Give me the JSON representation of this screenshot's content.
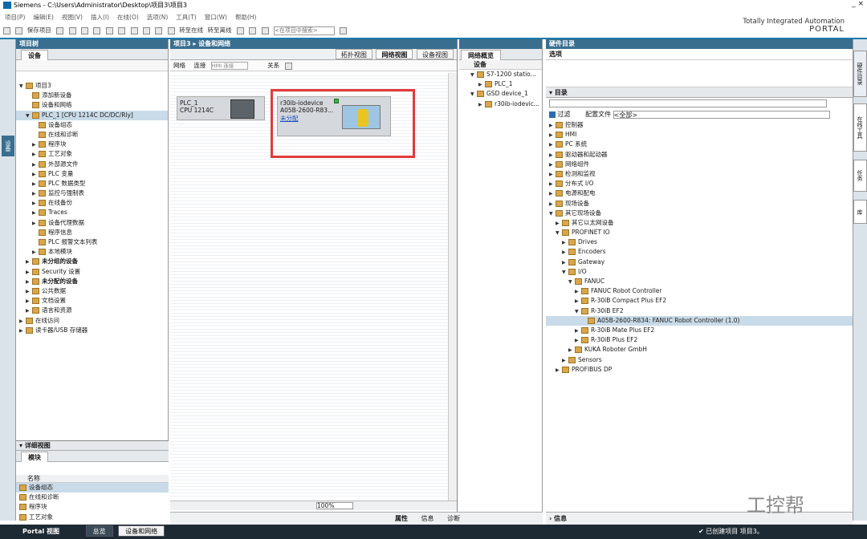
{
  "window": {
    "title": "Siemens  -  C:\\Users\\Administrator\\Desktop\\项目3\\项目3",
    "controls": "_ ×"
  },
  "menu": [
    "项目(P)",
    "编辑(E)",
    "视图(V)",
    "插入(I)",
    "在线(O)",
    "选项(N)",
    "工具(T)",
    "窗口(W)",
    "帮助(H)"
  ],
  "toolbar": {
    "save": "保存项目",
    "online": "转至在线",
    "offline": "转至离线",
    "search_placeholder": "<在项目中搜索>"
  },
  "brand": {
    "line1": "Totally Integrated Automation",
    "line2": "PORTAL"
  },
  "left_sidebar": {
    "tab": "设备"
  },
  "project_tree": {
    "header": "项目树",
    "tab": "设备",
    "items": [
      {
        "label": "项目3",
        "indent": 0,
        "arrow": "▼"
      },
      {
        "label": "添加新设备",
        "indent": 1,
        "arrow": ""
      },
      {
        "label": "设备和网络",
        "indent": 1,
        "arrow": ""
      },
      {
        "label": "PLC_1 [CPU 1214C DC/DC/Rly]",
        "indent": 1,
        "arrow": "▼",
        "selected": true
      },
      {
        "label": "设备组态",
        "indent": 2,
        "arrow": ""
      },
      {
        "label": "在线和诊断",
        "indent": 2,
        "arrow": ""
      },
      {
        "label": "程序块",
        "indent": 2,
        "arrow": "▶"
      },
      {
        "label": "工艺对象",
        "indent": 2,
        "arrow": "▶"
      },
      {
        "label": "外部源文件",
        "indent": 2,
        "arrow": "▶"
      },
      {
        "label": "PLC 变量",
        "indent": 2,
        "arrow": "▶"
      },
      {
        "label": "PLC 数据类型",
        "indent": 2,
        "arrow": "▶"
      },
      {
        "label": "监控与强制表",
        "indent": 2,
        "arrow": "▶"
      },
      {
        "label": "在线备份",
        "indent": 2,
        "arrow": "▶"
      },
      {
        "label": "Traces",
        "indent": 2,
        "arrow": "▶"
      },
      {
        "label": "设备代理数据",
        "indent": 2,
        "arrow": "▶"
      },
      {
        "label": "程序信息",
        "indent": 2,
        "arrow": ""
      },
      {
        "label": "PLC 报警文本列表",
        "indent": 2,
        "arrow": ""
      },
      {
        "label": "本地模块",
        "indent": 2,
        "arrow": "▶"
      },
      {
        "label": "未分组的设备",
        "indent": 1,
        "arrow": "▶",
        "bold": true
      },
      {
        "label": "Security 设置",
        "indent": 1,
        "arrow": "▶"
      },
      {
        "label": "未分配的设备",
        "indent": 1,
        "arrow": "▶",
        "bold": true
      },
      {
        "label": "公共数据",
        "indent": 1,
        "arrow": "▶"
      },
      {
        "label": "文档设置",
        "indent": 1,
        "arrow": "▶"
      },
      {
        "label": "语言和资源",
        "indent": 1,
        "arrow": "▶"
      },
      {
        "label": "在线访问",
        "indent": 0,
        "arrow": "▶"
      },
      {
        "label": "读卡器/USB 存储器",
        "indent": 0,
        "arrow": "▶"
      }
    ]
  },
  "detail_view": {
    "header": "详细视图",
    "tab": "模块",
    "column": "名称",
    "rows": [
      "设备组态",
      "在线和诊断",
      "程序块",
      "工艺对象"
    ]
  },
  "center": {
    "breadcrumb": "项目3 ▸ 设备和网络",
    "view_tabs": [
      "拓扑视图",
      "网络视图",
      "设备视图"
    ],
    "tools": {
      "network": "网络",
      "connect": "连接",
      "hmi_conn": "HMI 连接",
      "relation": "关系"
    },
    "plc": {
      "name": "PLC_1",
      "cpu": "CPU 1214C"
    },
    "device": {
      "name": "r30ib-iodevice",
      "model": "A05B-2600-R83...",
      "status": "未分配"
    },
    "zoom": "100%"
  },
  "overview": {
    "header": "网络概览",
    "col": "设备",
    "items": [
      {
        "label": "S7-1200 statio...",
        "indent": 1,
        "arrow": "▼"
      },
      {
        "label": "PLC_1",
        "indent": 2,
        "arrow": "▶"
      },
      {
        "label": "GSD device_1",
        "indent": 1,
        "arrow": "▼"
      },
      {
        "label": "r30ib-iodevic...",
        "indent": 2,
        "arrow": "▶"
      }
    ]
  },
  "catalog": {
    "header": "硬件目录",
    "options": "选项",
    "section": "目录",
    "filter": "过滤",
    "profile_label": "配置文件",
    "profile_value": "<全部>",
    "items": [
      {
        "label": "控制器",
        "indent": 0,
        "arrow": "▶"
      },
      {
        "label": "HMI",
        "indent": 0,
        "arrow": "▶"
      },
      {
        "label": "PC 系统",
        "indent": 0,
        "arrow": "▶"
      },
      {
        "label": "驱动器和起动器",
        "indent": 0,
        "arrow": "▶"
      },
      {
        "label": "网络组件",
        "indent": 0,
        "arrow": "▶"
      },
      {
        "label": "检测和监视",
        "indent": 0,
        "arrow": "▶"
      },
      {
        "label": "分布式 I/O",
        "indent": 0,
        "arrow": "▶"
      },
      {
        "label": "电源和配电",
        "indent": 0,
        "arrow": "▶"
      },
      {
        "label": "现场设备",
        "indent": 0,
        "arrow": "▶"
      },
      {
        "label": "其它现场设备",
        "indent": 0,
        "arrow": "▼"
      },
      {
        "label": "其它以太网设备",
        "indent": 1,
        "arrow": "▶"
      },
      {
        "label": "PROFINET IO",
        "indent": 1,
        "arrow": "▼"
      },
      {
        "label": "Drives",
        "indent": 2,
        "arrow": "▶"
      },
      {
        "label": "Encoders",
        "indent": 2,
        "arrow": "▶"
      },
      {
        "label": "Gateway",
        "indent": 2,
        "arrow": "▶"
      },
      {
        "label": "I/O",
        "indent": 2,
        "arrow": "▼"
      },
      {
        "label": "FANUC",
        "indent": 3,
        "arrow": "▼"
      },
      {
        "label": "FANUC Robot Controller",
        "indent": 4,
        "arrow": "▶"
      },
      {
        "label": "R-30iB Compact Plus EF2",
        "indent": 4,
        "arrow": "▶"
      },
      {
        "label": "R-30iB EF2",
        "indent": 4,
        "arrow": "▼"
      },
      {
        "label": "A05B-2600-R834: FANUC Robot Controller (1.0)",
        "indent": 5,
        "arrow": "",
        "selected": true
      },
      {
        "label": "R-30iB Mate Plus EF2",
        "indent": 4,
        "arrow": "▶"
      },
      {
        "label": "R-30iB Plus EF2",
        "indent": 4,
        "arrow": "▶"
      },
      {
        "label": "KUKA Roboter GmbH",
        "indent": 3,
        "arrow": "▶"
      },
      {
        "label": "Sensors",
        "indent": 2,
        "arrow": "▶"
      },
      {
        "label": "PROFIBUS DP",
        "indent": 1,
        "arrow": "▶"
      }
    ]
  },
  "right_tabs": [
    "硬件目录",
    "在线工具",
    "任务",
    "库"
  ],
  "bottom": {
    "properties": "属性",
    "info": "信息",
    "diagnostics": "诊断",
    "right_info": "信息",
    "portal": "Portal 视图",
    "overview_tab": "总览",
    "devnet_tab": "设备和网络",
    "status_msg": "已创建项目 项目3。",
    "watermark": "工控帮"
  }
}
